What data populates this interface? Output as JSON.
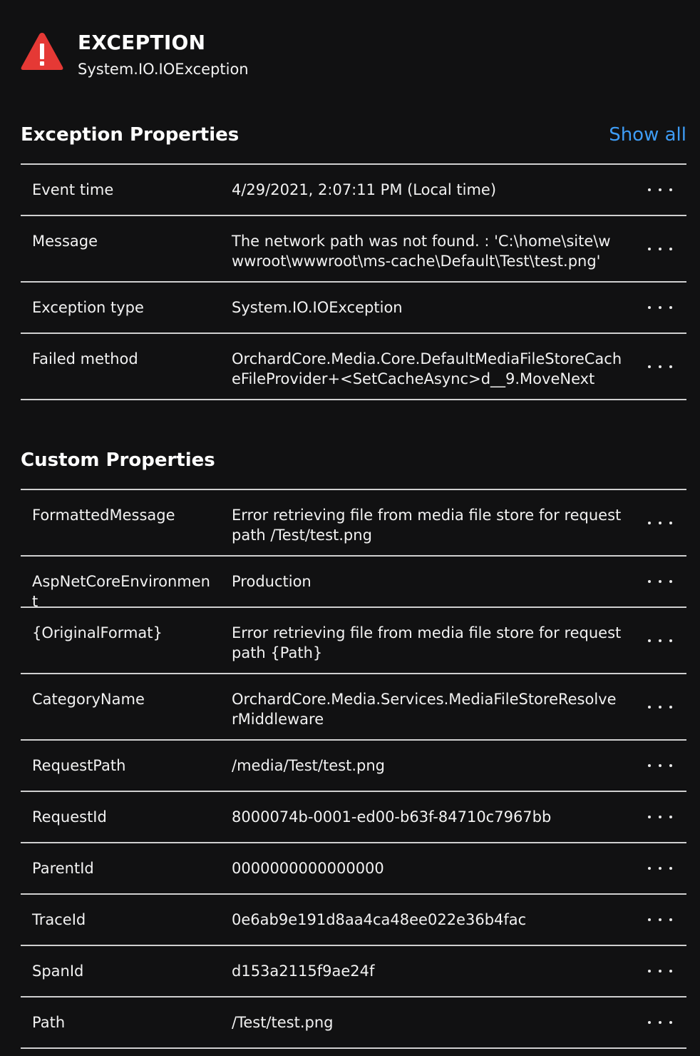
{
  "header": {
    "title": "EXCEPTION",
    "subtitle": "System.IO.IOException",
    "icon": "warning-triangle-icon",
    "icon_color": "#e53935"
  },
  "exception_properties": {
    "title": "Exception Properties",
    "show_all_label": "Show all",
    "rows": [
      {
        "key": "Event time",
        "value": "4/29/2021, 2:07:11 PM (Local time)"
      },
      {
        "key": "Message",
        "value": "The network path was not found. : 'C:\\home\\site\\wwwroot\\wwwroot\\ms-cache\\Default\\Test\\test.png'"
      },
      {
        "key": "Exception type",
        "value": "System.IO.IOException"
      },
      {
        "key": "Failed method",
        "value": "OrchardCore.Media.Core.DefaultMediaFileStoreCacheFileProvider+<SetCacheAsync>d__9.MoveNext"
      }
    ]
  },
  "custom_properties": {
    "title": "Custom Properties",
    "rows": [
      {
        "key": "FormattedMessage",
        "value": "Error retrieving file from media file store for request path /Test/test.png"
      },
      {
        "key": "AspNetCoreEnvironment",
        "value": "Production"
      },
      {
        "key": "{OriginalFormat}",
        "value": "Error retrieving file from media file store for request path {Path}"
      },
      {
        "key": "CategoryName",
        "value": "OrchardCore.Media.Services.MediaFileStoreResolverMiddleware"
      },
      {
        "key": "RequestPath",
        "value": "/media/Test/test.png"
      },
      {
        "key": "RequestId",
        "value": "8000074b-0001-ed00-b63f-84710c7967bb"
      },
      {
        "key": "ParentId",
        "value": "0000000000000000"
      },
      {
        "key": "TraceId",
        "value": "0e6ab9e191d8aa4ca48ee022e36b4fac"
      },
      {
        "key": "SpanId",
        "value": "d153a2115f9ae24f"
      },
      {
        "key": "Path",
        "value": "/Test/test.png"
      }
    ]
  },
  "colors": {
    "background": "#111112",
    "text": "#f2f2f2",
    "link": "#3e9cf5",
    "divider": "#d0d0d0"
  }
}
